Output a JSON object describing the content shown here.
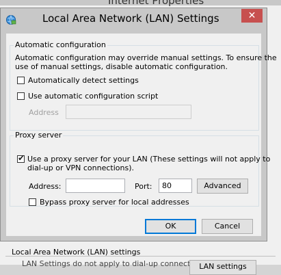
{
  "parent_window": {
    "title": "Internet Properties",
    "section_label": "Local Area Network (LAN) settings",
    "partial_text": "LAN Settings do not apply to dial-up connections.",
    "partial_button": "LAN settings"
  },
  "dialog": {
    "title": "Local Area Network (LAN) Settings",
    "close_symbol": "✕"
  },
  "auto_config": {
    "legend": "Automatic configuration",
    "description_line1": "Automatic configuration may override manual settings.  To ensure the",
    "description_line2": "use of manual settings, disable automatic configuration.",
    "detect_label": "Automatically detect settings",
    "detect_checked": false,
    "script_label": "Use automatic configuration script",
    "script_checked": false,
    "address_label": "Address",
    "address_value": ""
  },
  "proxy": {
    "legend": "Proxy server",
    "use_label_line1": "Use a proxy server for your LAN (These settings will not apply to",
    "use_label_line2": "dial-up or VPN connections).",
    "use_checked": true,
    "check_symbol": "✔",
    "address_label": "Address:",
    "address_value": "",
    "port_label": "Port:",
    "port_value": "80",
    "advanced_label": "Advanced",
    "bypass_label": "Bypass proxy server for local addresses",
    "bypass_checked": false
  },
  "buttons": {
    "ok": "OK",
    "cancel": "Cancel"
  }
}
